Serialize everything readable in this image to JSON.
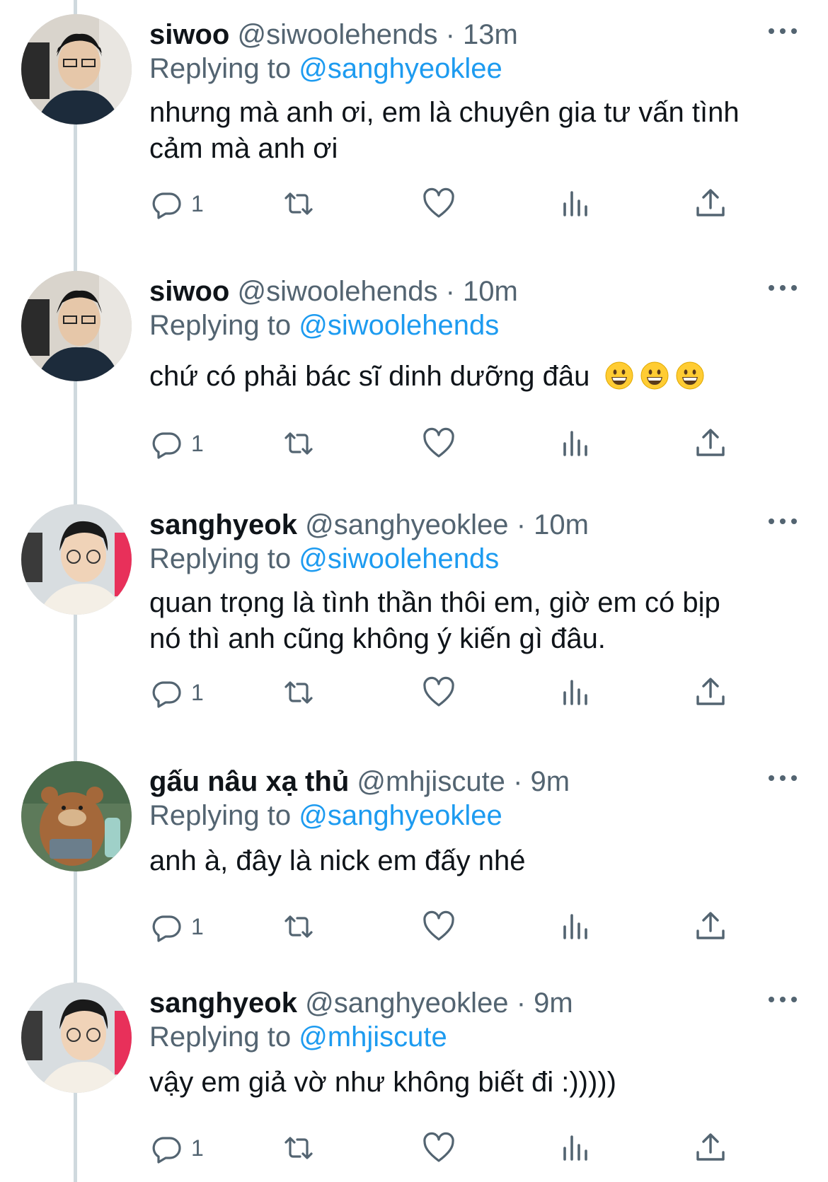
{
  "tweets": [
    {
      "name": "siwoo",
      "handle": "@siwoolehends",
      "sep": "·",
      "time": "13m",
      "replying_prefix": "Replying to ",
      "replying_to": "@sanghyeoklee",
      "text_lines": [
        "nhưng mà anh ơi, em là chuyên gia tư vấn tình",
        "cảm mà anh ơi"
      ],
      "reply_count": "1"
    },
    {
      "name": "siwoo",
      "handle": "@siwoolehends",
      "sep": "·",
      "time": "10m",
      "replying_prefix": "Replying to ",
      "replying_to": "@siwoolehends",
      "text_lines": [
        "chứ có phải bác sĩ dinh dưỡng đâu"
      ],
      "emoji": "grinning-face-emoji",
      "reply_count": "1"
    },
    {
      "name": "sanghyeok",
      "handle": "@sanghyeoklee",
      "sep": "·",
      "time": "10m",
      "replying_prefix": "Replying to ",
      "replying_to": "@siwoolehends",
      "text_lines": [
        "quan trọng là tình thần thôi em, giờ em có bịp",
        "nó thì anh cũng không ý kiến gì đâu."
      ],
      "reply_count": "1"
    },
    {
      "name": "gấu nâu xạ thủ",
      "handle": "@mhjiscute",
      "sep": "·",
      "time": "9m",
      "replying_prefix": "Replying to ",
      "replying_to": "@sanghyeoklee",
      "text_lines": [
        "anh à, đây là nick em đấy nhé"
      ],
      "reply_count": "1"
    },
    {
      "name": "sanghyeok",
      "handle": "@sanghyeoklee",
      "sep": "·",
      "time": "9m",
      "replying_prefix": "Replying to ",
      "replying_to": "@mhjiscute",
      "text_lines": [
        "vậy em giả vờ như không biết đi :)))))"
      ],
      "reply_count": "1"
    }
  ],
  "icons": {
    "reply": "reply-icon",
    "retweet": "retweet-icon",
    "like": "heart-icon",
    "views": "views-icon",
    "share": "share-icon",
    "more": "more-icon"
  },
  "colors": {
    "link": "#1d9bf0",
    "secondary": "#536471",
    "thread_line": "#cfd9de"
  }
}
